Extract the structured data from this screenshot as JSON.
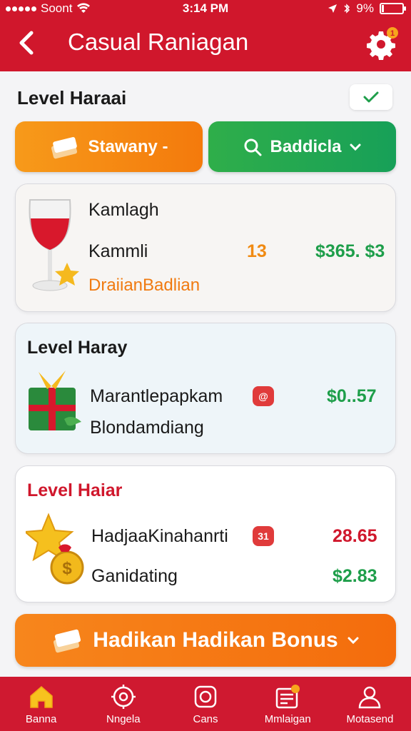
{
  "status_bar": {
    "carrier": "Soont",
    "time": "3:14 PM",
    "battery": "9%"
  },
  "header": {
    "title": "Casual Raniagan",
    "settings_badge": "1"
  },
  "section": {
    "title": "Level Haraai"
  },
  "actions": {
    "primary_label": "Stawany -",
    "search_label": "Baddicla"
  },
  "cards": [
    {
      "title": "Kamlagh",
      "name": "Kammli",
      "quantity": "13",
      "price": "$365. $3",
      "subtitle": "DraiianBadlian"
    },
    {
      "title": "Level Haray",
      "name": "Marantlepapkam",
      "badge": "@",
      "price": "$0..57",
      "subtitle": "Blondamdiang"
    },
    {
      "title": "Level Haiar",
      "name": "HadjaaKinahanrti",
      "badge": "31",
      "price_top": "28.65",
      "subtitle": "Ganidating",
      "price": "$2.83"
    }
  ],
  "bonus": {
    "label": "Hadikan Hadikan Bonus"
  },
  "tabs": [
    {
      "label": "Banna",
      "icon": "home-icon",
      "active": true
    },
    {
      "label": "Nngela",
      "icon": "gear-badge-icon"
    },
    {
      "label": "Cans",
      "icon": "coin-icon"
    },
    {
      "label": "Mmlaigan",
      "icon": "receipt-icon"
    },
    {
      "label": "Motasend",
      "icon": "user-icon"
    }
  ],
  "colors": {
    "brand_red": "#d0172c",
    "accent_orange": "#f47a0c",
    "accent_green": "#1e9e4a"
  }
}
